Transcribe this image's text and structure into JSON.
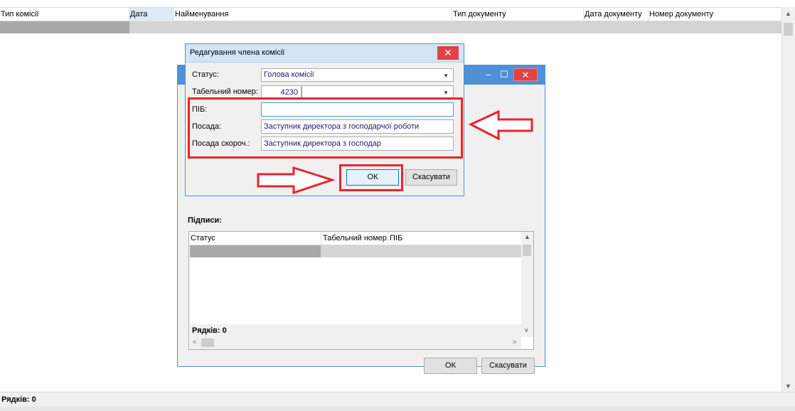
{
  "main_grid": {
    "columns": [
      {
        "label": "Тип комісії"
      },
      {
        "label": "Дата"
      },
      {
        "label": "Найменування"
      },
      {
        "label": "Тип документу"
      },
      {
        "label": "Дата документу"
      },
      {
        "label": "Номер документу"
      }
    ],
    "rows_label": "Рядків: 0"
  },
  "bg_dialog": {
    "min_icon": "minimize-icon",
    "max_icon": "maximize-icon",
    "close_icon": "close-icon",
    "signatures_label": "Підписи:",
    "signatures_columns": [
      "Статус",
      "Табельний номер",
      "ПІБ"
    ],
    "signatures_rows_label": "Рядків: 0",
    "ok_label": "ОК",
    "cancel_label": "Скасувати"
  },
  "fg_dialog": {
    "title": "Редагування члена комісії",
    "close_icon": "close-icon",
    "status_label": "Статус:",
    "status_value": "Голова комісії",
    "tab_label": "Табельний номер:",
    "tab_value": "4230",
    "pib_label": "ПІБ:",
    "pib_value": "",
    "posada_label": "Посада:",
    "posada_value": "Заступник директора з господарчої роботи",
    "posada_short_label": "Посада скороч.:",
    "posada_short_value": "Заступник директора з господар",
    "ok_label": "ОК",
    "cancel_label": "Скасувати"
  },
  "colors": {
    "highlight": "#e8252c",
    "title_bar": "#4f90d8",
    "close_button": "#e04343"
  }
}
